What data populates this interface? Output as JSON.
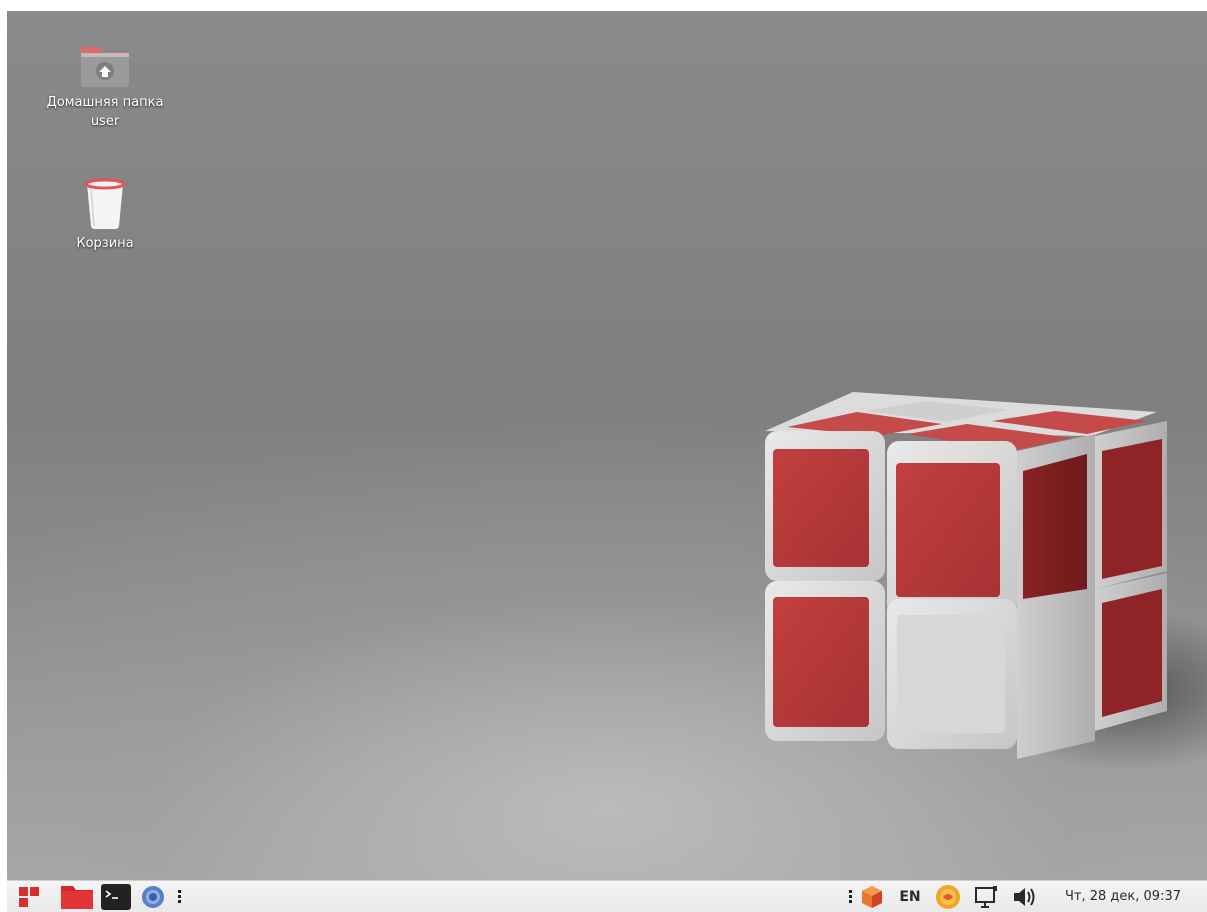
{
  "desktop": {
    "icons": [
      {
        "label_line1": "Домашняя папка",
        "label_line2": "user",
        "icon": "home-folder-icon"
      },
      {
        "label": "Корзина",
        "icon": "trash-icon"
      }
    ],
    "wallpaper": {
      "subject": "2x2 cube",
      "colors": {
        "red": "#b8383a",
        "white": "#d8d8d8",
        "background": "#848484"
      }
    }
  },
  "taskbar": {
    "start_icon": "start-menu-icon",
    "tasks": [
      {
        "icon": "file-manager-icon"
      },
      {
        "icon": "terminal-icon"
      },
      {
        "icon": "browser-icon"
      }
    ],
    "tray": {
      "language": "EN",
      "clock": "Чт, 28 дек, 09:37",
      "icons": [
        "update-icon",
        "fly-icon",
        "display-icon",
        "volume-icon"
      ]
    },
    "accent": "#d62f2f"
  }
}
